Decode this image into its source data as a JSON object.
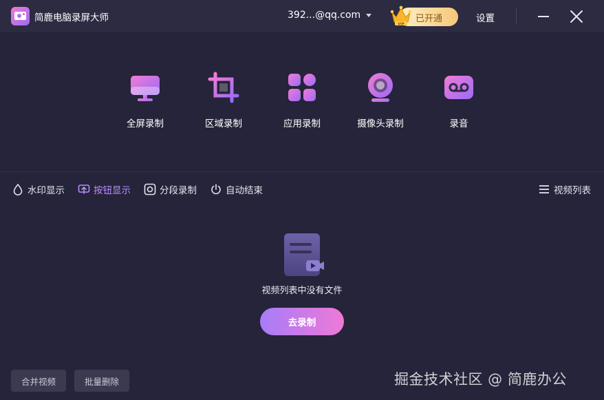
{
  "titlebar": {
    "app_title": "简鹿电脑录屏大师",
    "account": "392...@qq.com",
    "vip_label": "已开通",
    "settings_label": "设置"
  },
  "modes": [
    {
      "label": "全屏录制",
      "icon": "monitor-icon"
    },
    {
      "label": "区域录制",
      "icon": "crop-icon"
    },
    {
      "label": "应用录制",
      "icon": "apps-grid-icon"
    },
    {
      "label": "摄像头录制",
      "icon": "webcam-icon"
    },
    {
      "label": "录音",
      "icon": "audio-tape-icon"
    }
  ],
  "options": {
    "watermark": "水印显示",
    "button_display": "按钮显示",
    "segment_record": "分段录制",
    "auto_end": "自动结束",
    "video_list": "视频列表"
  },
  "empty_state": {
    "message": "视频列表中没有文件",
    "record_button": "去录制"
  },
  "footer": {
    "merge_label": "合并视频",
    "batch_delete_label": "批量删除"
  },
  "watermark_text": "掘金技术社区 @ 简鹿办公",
  "colors": {
    "background": "#25243a",
    "titlebar": "#2c2b41",
    "accent_purple": "#a77cf8",
    "accent_pink": "#ef79d7",
    "active_option": "#b88cff",
    "vip_gold": "#f5c77a"
  }
}
